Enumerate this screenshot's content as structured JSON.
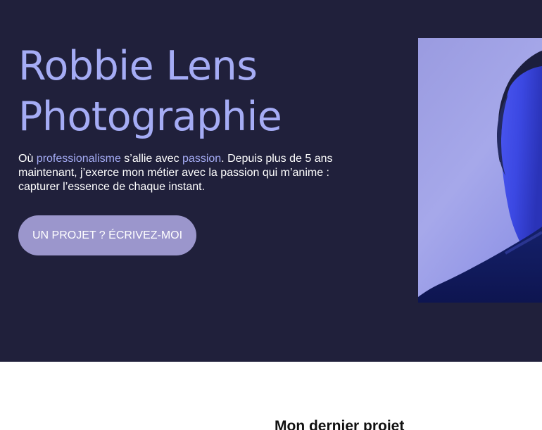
{
  "hero": {
    "title_line1": "Robbie Lens",
    "title_line2": "Photographie",
    "intro": {
      "part1": "Où ",
      "highlight1": "professionalisme",
      "part2": " s’allie avec ",
      "highlight2": "passion",
      "part3": ". Depuis plus de 5 ans maintenant, j’exerce mon métier avec la passion qui m’anime : capturer l’essence de chaque instant."
    },
    "cta_label": "UN PROJET ? ÉCRIVEZ-MOI",
    "photo_icon": "portrait-photo"
  },
  "colors": {
    "hero_background": "#20203b",
    "accent": "#a5acf5",
    "button": "#9b96cc"
  },
  "projects": {
    "section_title": "Mon dernier projet"
  }
}
